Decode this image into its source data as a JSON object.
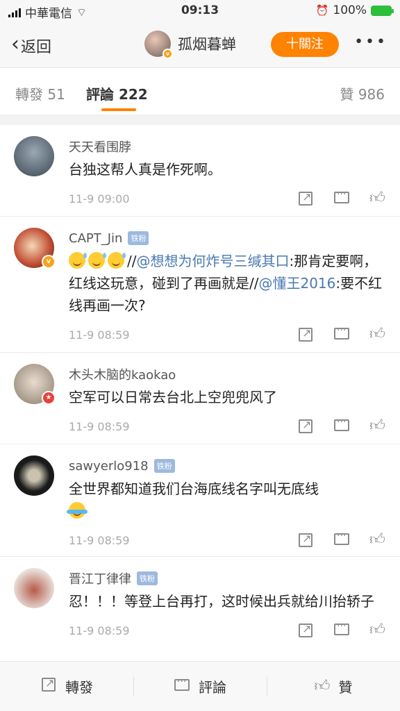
{
  "status_bar": {
    "carrier": "中華電信",
    "time": "09:13",
    "battery": "100%"
  },
  "nav": {
    "back_label": "返回",
    "username": "孤烟暮蝉",
    "follow_label": "十關注",
    "more": "•••"
  },
  "tabs": {
    "repost": "轉發 51",
    "comments": "評論 222",
    "likes": "贊 986"
  },
  "colors": {
    "accent": "#ff8200",
    "mention": "#4a78b0",
    "fan_badge": "#9db9df"
  },
  "comments": [
    {
      "name": "天天看围脖",
      "fan_badge": "",
      "text": "台独这帮人真是作死啊。",
      "time": "11-9 09:00"
    },
    {
      "name": "CAPT_Jin",
      "fan_badge": "铁粉",
      "text_prefix": "//",
      "mention1": "@想想为何炸号三缄其口",
      "text_mid": ":那肯定要啊，红线这玩意，碰到了再画就是//",
      "mention2": "@懂王2016",
      "text_end": ":要不红线再画一次?",
      "time": "11-9 08:59"
    },
    {
      "name": "木头木脑的kaokao",
      "fan_badge": "",
      "text": "空军可以日常去台北上空兜兜风了",
      "time": "11-9 08:59"
    },
    {
      "name": "sawyerlo918",
      "fan_badge": "铁粉",
      "text": "全世界都知道我们台海底线名字叫无底线",
      "time": "11-9 08:59"
    },
    {
      "name": "晋江丁律律",
      "fan_badge": "铁粉",
      "text": "忍！！！等登上台再打，这时候出兵就给川抬轿子",
      "time": "11-9 08:59"
    }
  ],
  "bottom_bar": {
    "repost": "轉發",
    "comment": "評論",
    "like": "贊"
  }
}
